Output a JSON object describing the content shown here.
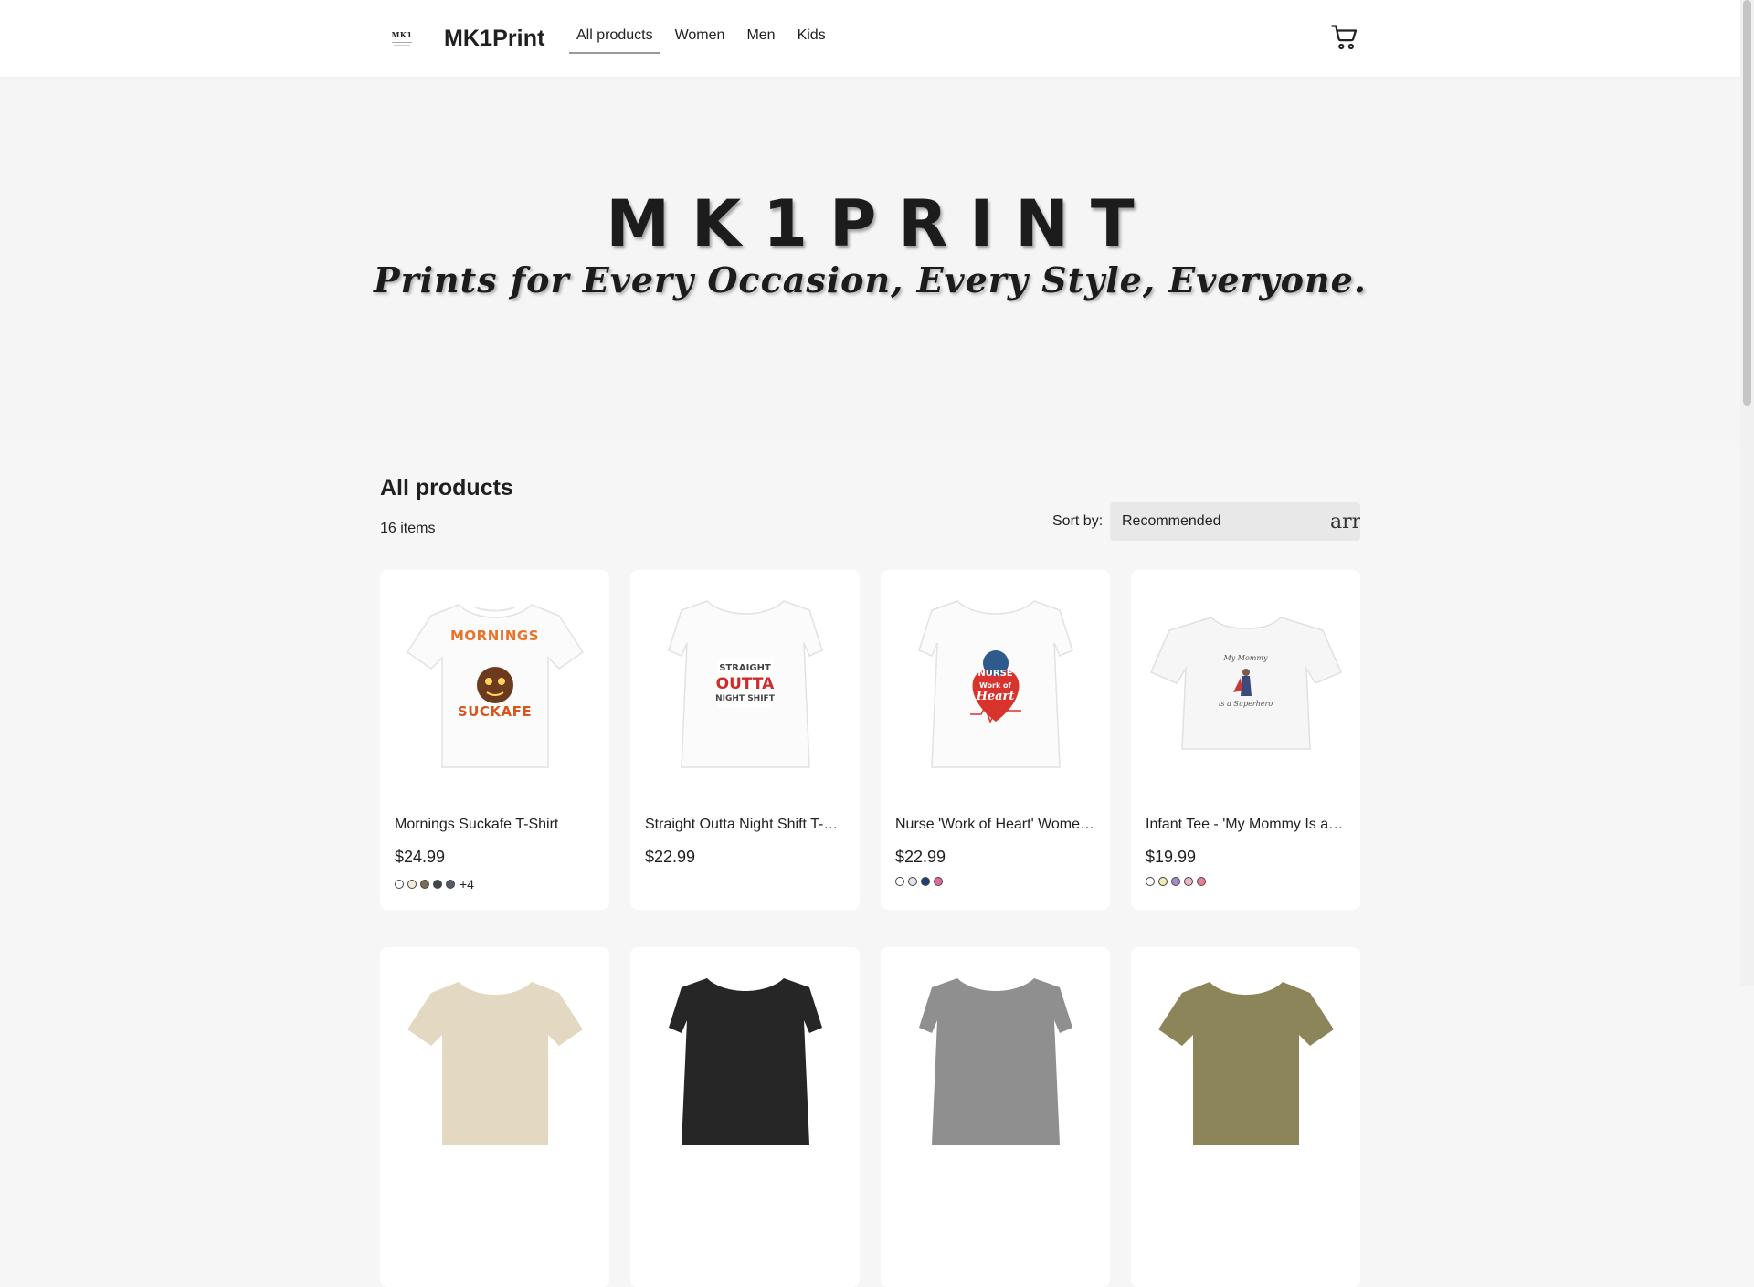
{
  "header": {
    "logo_text": "MK1",
    "brand": "MK1Print",
    "nav": [
      {
        "label": "All products",
        "active": true
      },
      {
        "label": "Women",
        "active": false
      },
      {
        "label": "Men",
        "active": false
      },
      {
        "label": "Kids",
        "active": false
      }
    ],
    "cart_icon": "shopping-cart-icon"
  },
  "hero": {
    "title": "MK1PRINT",
    "tagline": "Prints for Every Occasion, Every Style, Everyone."
  },
  "products_section": {
    "title": "All products",
    "count": "16 items",
    "sort_label": "Sort by:",
    "sort_value": "Recommended",
    "sort_icon_text": "arrow_drop_down"
  },
  "products": [
    {
      "title": "Mornings Suckafe T-Shirt",
      "price": "$24.99",
      "swatches": [
        "#ffffff",
        "#f2ecd9",
        "#7a6c55",
        "#3f4a3f",
        "#555c63"
      ],
      "more": "+4",
      "print": [
        "MORNINGS",
        "SUCKAFE"
      ]
    },
    {
      "title": "Straight Outta Night Shift T-Shirt",
      "price": "$22.99",
      "swatches": [],
      "more": "",
      "print": [
        "STRAIGHT",
        "OUTTA",
        "NIGHT SHIFT"
      ]
    },
    {
      "title": "Nurse 'Work of Heart' Women's Tee",
      "price": "$22.99",
      "swatches": [
        "#ffffff",
        "#dde5ee",
        "#1e3f7a",
        "#e0679c"
      ],
      "more": "",
      "print": [
        "NURSE",
        "Work of",
        "Heart"
      ]
    },
    {
      "title": "Infant Tee - 'My Mommy Is a Superhero'",
      "price": "$19.99",
      "swatches": [
        "#ffffff",
        "#f1e9b0",
        "#a48ac8",
        "#f0b3c8",
        "#e88090"
      ],
      "more": "",
      "print": [
        "My Mommy",
        "is a Superhero"
      ]
    }
  ],
  "colors": {
    "page_bg": "#f6f6f6",
    "card_bg": "#ffffff",
    "sort_bg": "#e8e8e8"
  }
}
